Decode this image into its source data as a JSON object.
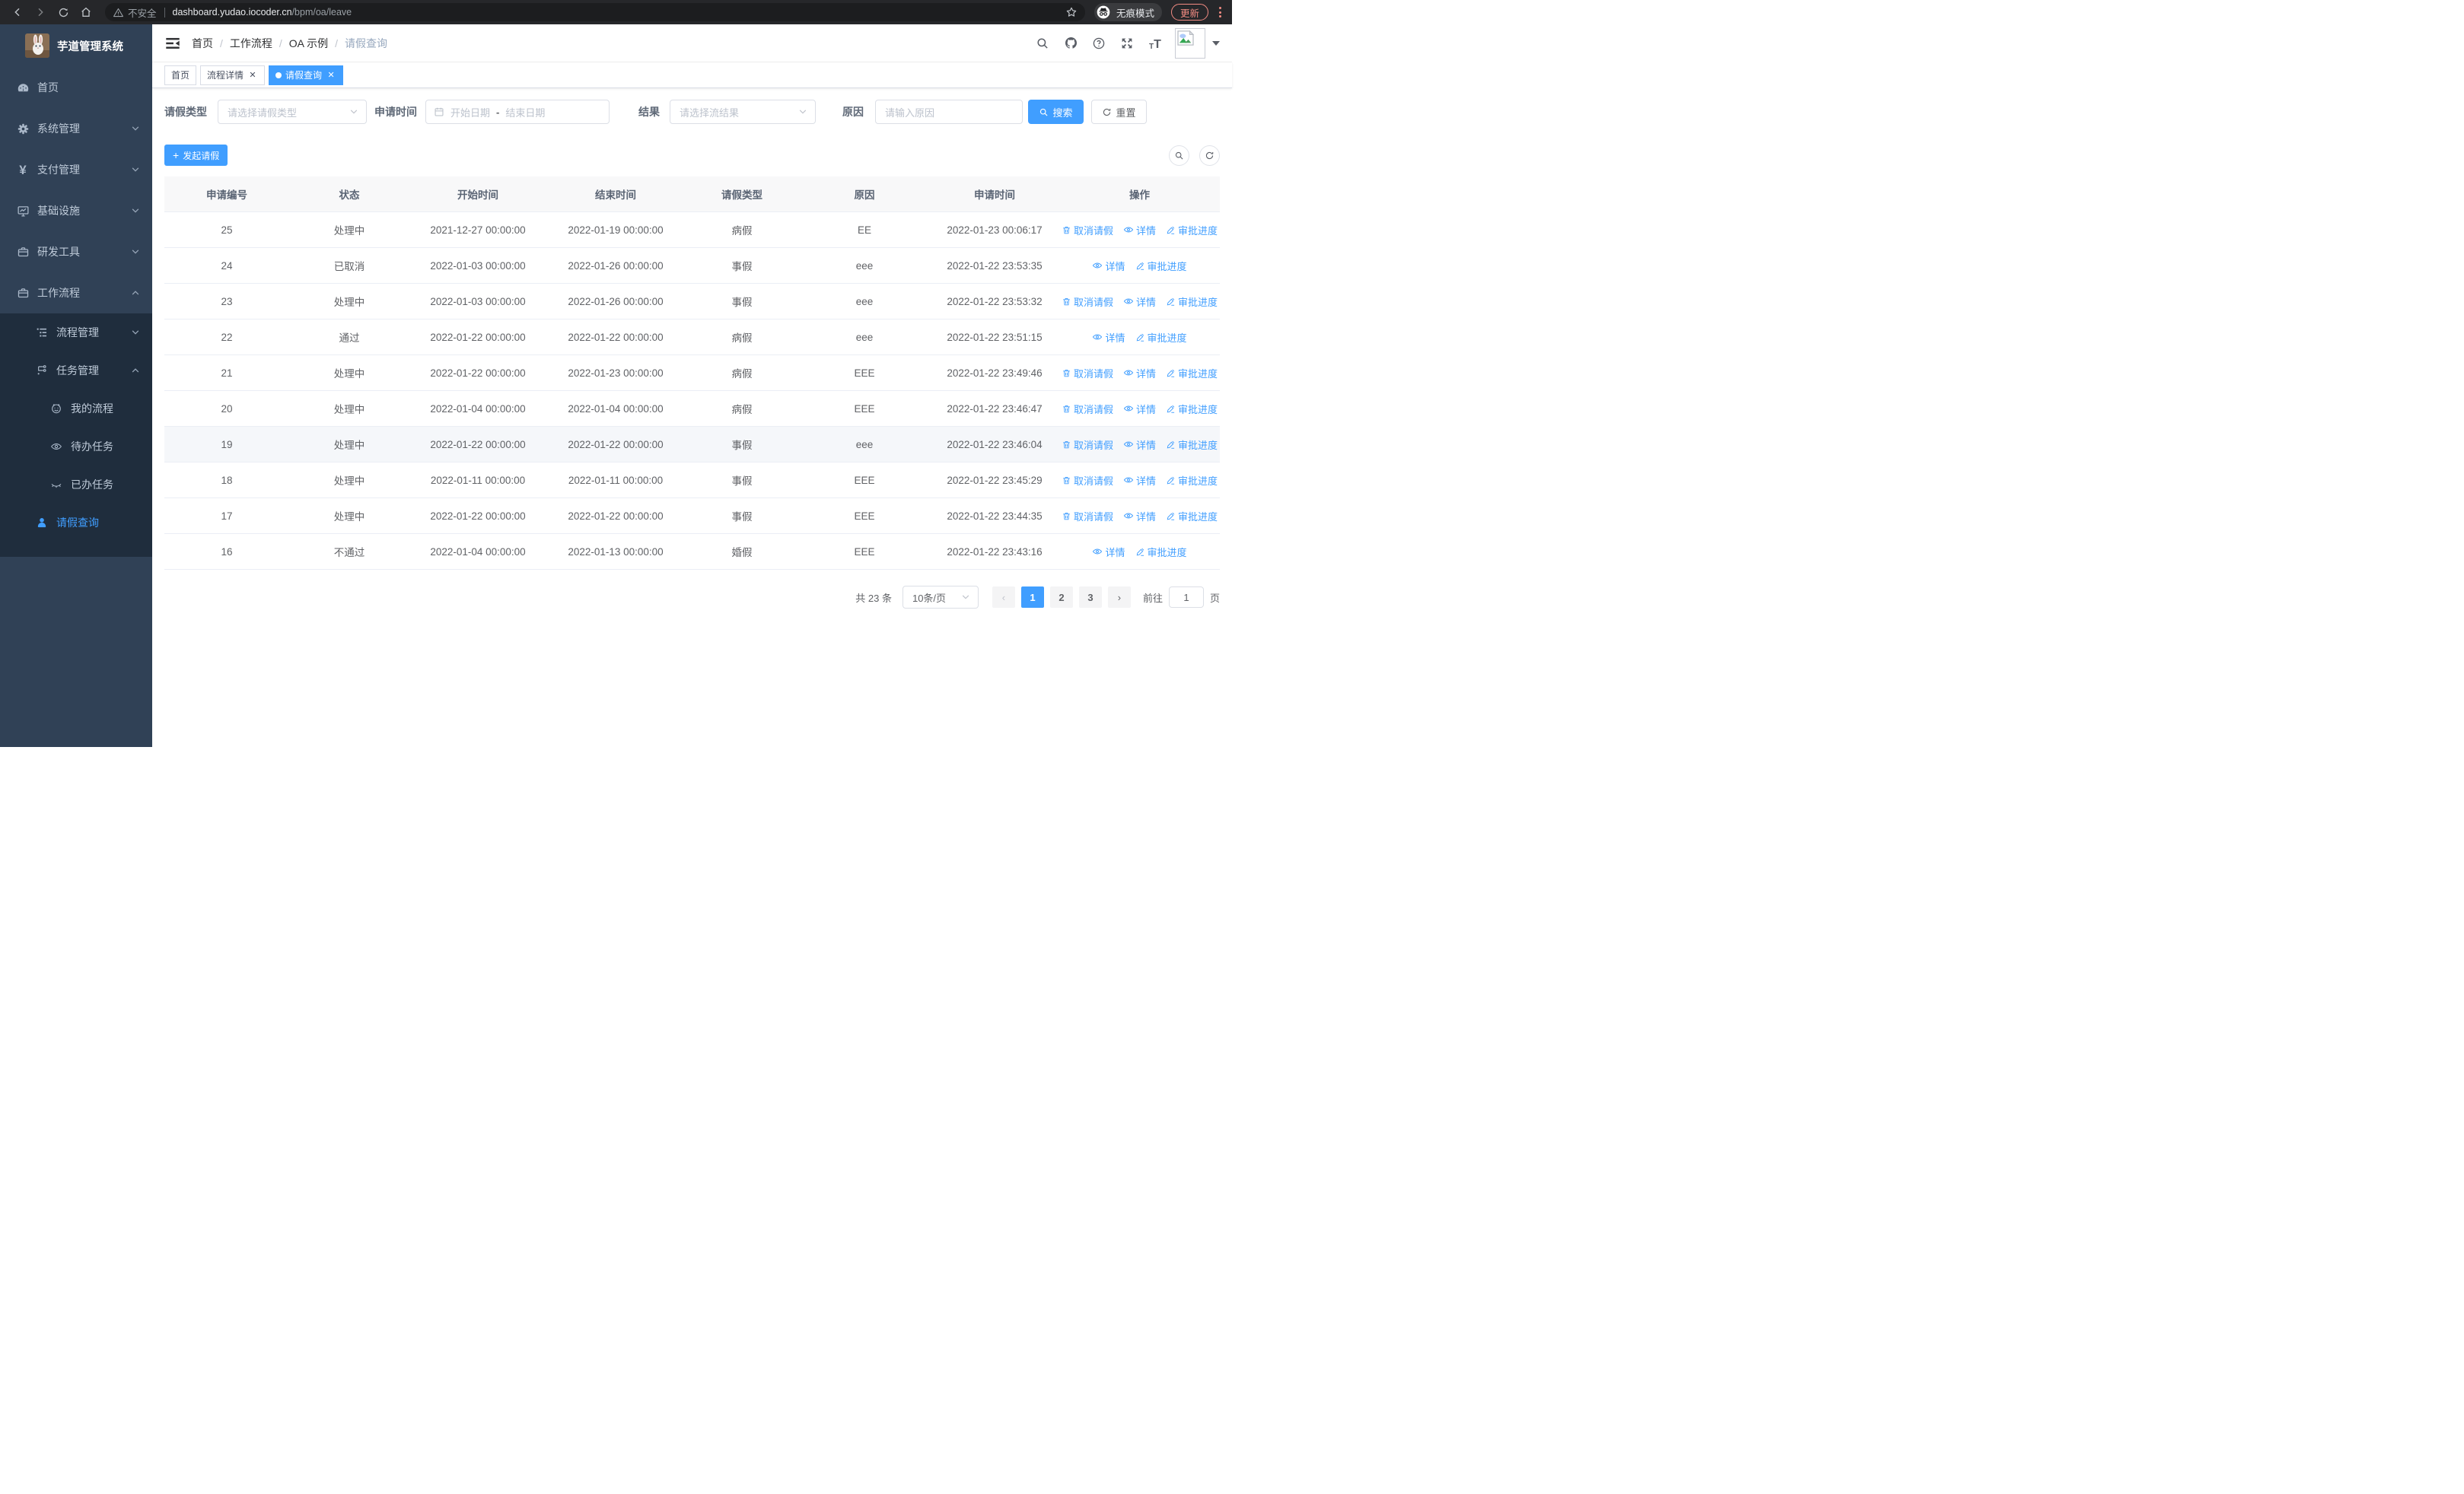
{
  "browser": {
    "security_label": "不安全",
    "url_host": "dashboard.yudao.iocoder.cn",
    "url_path": "/bpm/oa/leave",
    "incognito_label": "无痕模式",
    "update_label": "更新"
  },
  "sidebar": {
    "app_title": "芋道管理系统",
    "home": "首页",
    "system": "系统管理",
    "payment": "支付管理",
    "infra": "基础设施",
    "devtools": "研发工具",
    "workflow": "工作流程",
    "process_mgmt": "流程管理",
    "task_mgmt": "任务管理",
    "my_process": "我的流程",
    "todo_task": "待办任务",
    "done_task": "已办任务",
    "leave_query": "请假查询"
  },
  "header": {
    "breadcrumb": [
      "首页",
      "工作流程",
      "OA 示例",
      "请假查询"
    ]
  },
  "tabs": [
    {
      "label": "首页",
      "closable": false,
      "active": false
    },
    {
      "label": "流程详情",
      "closable": true,
      "active": false
    },
    {
      "label": "请假查询",
      "closable": true,
      "active": true
    }
  ],
  "filters": {
    "leave_type_label": "请假类型",
    "leave_type_placeholder": "请选择请假类型",
    "apply_time_label": "申请时间",
    "start_date_placeholder": "开始日期",
    "range_separator": "-",
    "end_date_placeholder": "结束日期",
    "result_label": "结果",
    "result_placeholder": "请选择流结果",
    "reason_label": "原因",
    "reason_placeholder": "请输入原因",
    "search_label": "搜索",
    "reset_label": "重置"
  },
  "toolbar": {
    "create_label": "发起请假"
  },
  "table": {
    "columns": [
      "申请编号",
      "状态",
      "开始时间",
      "结束时间",
      "请假类型",
      "原因",
      "申请时间",
      "操作"
    ],
    "action_labels": {
      "cancel": "取消请假",
      "detail": "详情",
      "progress": "审批进度"
    },
    "rows": [
      {
        "id": "25",
        "status": "处理中",
        "start": "2021-12-27 00:00:00",
        "end": "2022-01-19 00:00:00",
        "type": "病假",
        "reason": "EE",
        "applied": "2022-01-23 00:06:17",
        "cancellable": true,
        "hover": false
      },
      {
        "id": "24",
        "status": "已取消",
        "start": "2022-01-03 00:00:00",
        "end": "2022-01-26 00:00:00",
        "type": "事假",
        "reason": "eee",
        "applied": "2022-01-22 23:53:35",
        "cancellable": false,
        "hover": false
      },
      {
        "id": "23",
        "status": "处理中",
        "start": "2022-01-03 00:00:00",
        "end": "2022-01-26 00:00:00",
        "type": "事假",
        "reason": "eee",
        "applied": "2022-01-22 23:53:32",
        "cancellable": true,
        "hover": false
      },
      {
        "id": "22",
        "status": "通过",
        "start": "2022-01-22 00:00:00",
        "end": "2022-01-22 00:00:00",
        "type": "病假",
        "reason": "eee",
        "applied": "2022-01-22 23:51:15",
        "cancellable": false,
        "hover": false
      },
      {
        "id": "21",
        "status": "处理中",
        "start": "2022-01-22 00:00:00",
        "end": "2022-01-23 00:00:00",
        "type": "病假",
        "reason": "EEE",
        "applied": "2022-01-22 23:49:46",
        "cancellable": true,
        "hover": false
      },
      {
        "id": "20",
        "status": "处理中",
        "start": "2022-01-04 00:00:00",
        "end": "2022-01-04 00:00:00",
        "type": "病假",
        "reason": "EEE",
        "applied": "2022-01-22 23:46:47",
        "cancellable": true,
        "hover": false
      },
      {
        "id": "19",
        "status": "处理中",
        "start": "2022-01-22 00:00:00",
        "end": "2022-01-22 00:00:00",
        "type": "事假",
        "reason": "eee",
        "applied": "2022-01-22 23:46:04",
        "cancellable": true,
        "hover": true
      },
      {
        "id": "18",
        "status": "处理中",
        "start": "2022-01-11 00:00:00",
        "end": "2022-01-11 00:00:00",
        "type": "事假",
        "reason": "EEE",
        "applied": "2022-01-22 23:45:29",
        "cancellable": true,
        "hover": false
      },
      {
        "id": "17",
        "status": "处理中",
        "start": "2022-01-22 00:00:00",
        "end": "2022-01-22 00:00:00",
        "type": "事假",
        "reason": "EEE",
        "applied": "2022-01-22 23:44:35",
        "cancellable": true,
        "hover": false
      },
      {
        "id": "16",
        "status": "不通过",
        "start": "2022-01-04 00:00:00",
        "end": "2022-01-13 00:00:00",
        "type": "婚假",
        "reason": "EEE",
        "applied": "2022-01-22 23:43:16",
        "cancellable": false,
        "hover": false
      }
    ]
  },
  "pagination": {
    "total_text": "共 23 条",
    "page_size": "10条/页",
    "pages": [
      "1",
      "2",
      "3"
    ],
    "active_page": "1",
    "goto_label": "前往",
    "goto_value": "1",
    "page_suffix": "页"
  },
  "colors": {
    "accent": "#409eff",
    "sidebar_bg": "#304156",
    "submenu_bg": "#1f2d3d",
    "sidebar_text": "#bfcbd9",
    "update_chip": "#f28b82",
    "table_header_bg": "#f8f8f9",
    "row_border": "#ebeef5"
  }
}
